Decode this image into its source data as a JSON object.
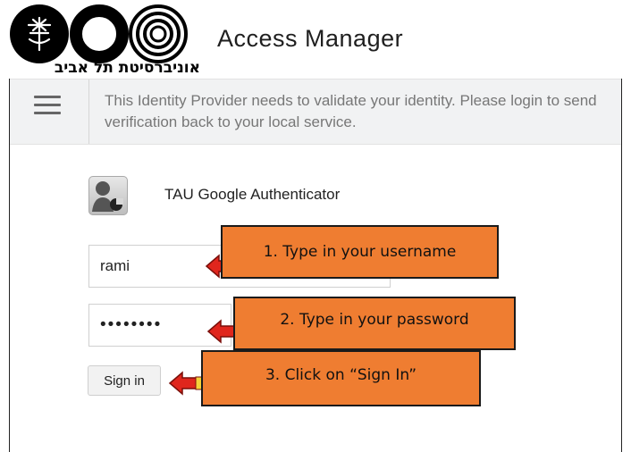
{
  "header": {
    "app_title": "Access Manager",
    "logo_caption": "אוניברסיטת תל אביב"
  },
  "infobar": {
    "line1": "This Identity Provider needs to validate your identity. Please login to send",
    "line2": "verification back to your local service."
  },
  "auth": {
    "name": "TAU Google Authenticator"
  },
  "form": {
    "username_value": "rami",
    "password_value": "••••••••",
    "signin_label": "Sign in"
  },
  "annotations": {
    "step1": "1. Type in your username",
    "step2": "2. Type in your password",
    "step3": "3. Click on “Sign In”"
  },
  "colors": {
    "callout": "#ef7d31",
    "arrow": "#e0261d",
    "infobar_bg": "#f1f2f3"
  }
}
